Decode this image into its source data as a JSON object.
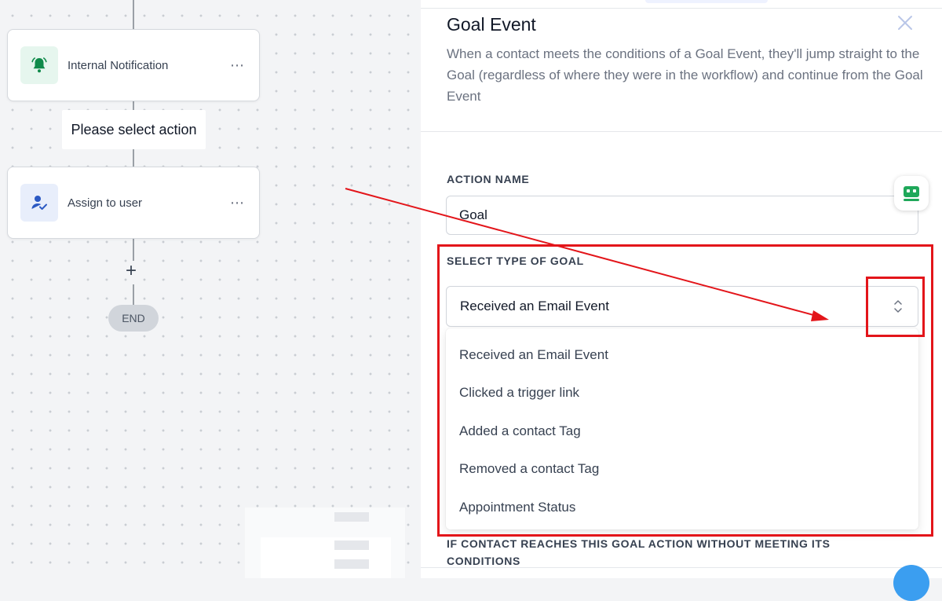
{
  "canvas": {
    "nodes": [
      {
        "label": "Internal Notification",
        "icon": "bell-icon",
        "icon_bg": "#e6f6ee",
        "icon_color": "#0f8a4a",
        "more": "⋯"
      },
      {
        "label": "Assign to user",
        "icon": "user-check-icon",
        "icon_bg": "#e8eefb",
        "icon_color": "#2b59c3",
        "more": "⋯"
      }
    ],
    "tooltip": "Please select action",
    "add_symbol": "+",
    "end_label": "END"
  },
  "panel": {
    "title": "Goal Event",
    "description": "When a contact meets the conditions of a Goal Event, they'll jump straight to the Goal (regardless of where they were in the workflow) and continue from the Goal Event",
    "close_icon": "close-icon",
    "action_name": {
      "label": "ACTION NAME",
      "value": "Goal"
    },
    "goal_type": {
      "label": "SELECT TYPE OF GOAL",
      "selected": "Received an Email Event",
      "options": [
        "Received an Email Event",
        "Clicked a trigger link",
        "Added a contact Tag",
        "Removed a contact Tag",
        "Appointment Status"
      ]
    },
    "bottom_label": "IF CONTACT REACHES THIS GOAL ACTION WITHOUT MEETING ITS CONDITIONS"
  },
  "colors": {
    "annotation": "#e3151a",
    "fab": "#3b9ef0",
    "bot_widget_icon": "#1fa85a"
  }
}
